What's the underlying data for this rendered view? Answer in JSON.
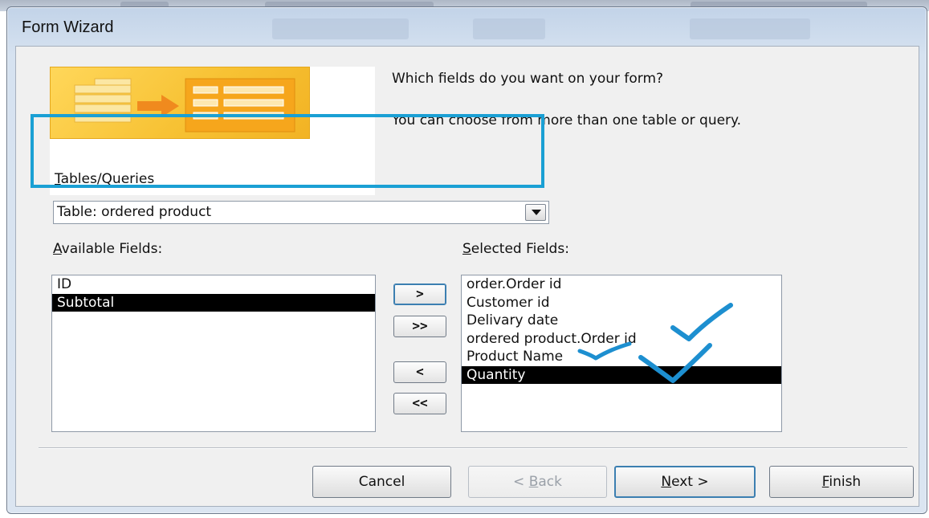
{
  "window": {
    "title": "Form Wizard"
  },
  "prompt": {
    "line1": "Which fields do you want on your form?",
    "line2": "You can choose from more than one table or query."
  },
  "tables_queries": {
    "label_accel": "T",
    "label_rest": "ables/Queries",
    "selected": "Table: ordered product"
  },
  "available_fields": {
    "label_accel": "A",
    "label_rest": "vailable Fields:",
    "items": [
      "ID",
      "Subtotal"
    ],
    "selected_index": 1
  },
  "selected_fields": {
    "label_accel": "S",
    "label_rest": "elected Fields:",
    "items": [
      "order.Order id",
      "Customer id",
      "Delivary date",
      "ordered product.Order id",
      "Product Name",
      "Quantity"
    ],
    "selected_index": 5
  },
  "move_buttons": {
    "add_one": ">",
    "add_all": ">>",
    "remove_one": "<",
    "remove_all": "<<"
  },
  "buttons": {
    "cancel": "Cancel",
    "back_pre": "< ",
    "back_accel": "B",
    "back_rest": "ack",
    "next_accel": "N",
    "next_rest": "ext >",
    "finish_accel": "F",
    "finish_rest": "inish"
  },
  "colors": {
    "highlight": "#1aa0d4",
    "checkmark": "#1d8fd0",
    "selection": "#000000"
  }
}
